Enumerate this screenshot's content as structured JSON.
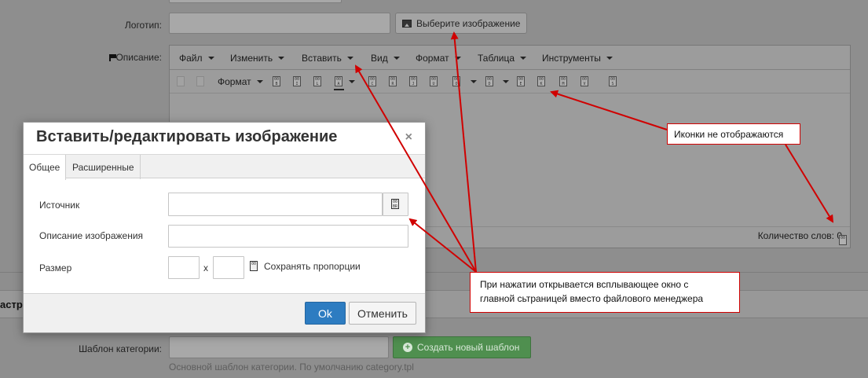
{
  "form": {
    "logo_label": "Логотип:",
    "choose_image_button": "Выберите изображение",
    "description_label": "Описание:",
    "section_partial": "астр",
    "category_template_label": "Шаблон категории:",
    "create_template_button": "Создать новый шаблон",
    "category_template_hint": "Основной шаблон категории. По умолчанию category.tpl"
  },
  "editor": {
    "menu": [
      "Файл",
      "Изменить",
      "Вставить",
      "Вид",
      "Формат",
      "Таблица",
      "Инструменты"
    ],
    "toolbar_format": "Формат",
    "word_count": "Количество слов: 0"
  },
  "dialog": {
    "title": "Вставить/редактировать изображение",
    "close": "×",
    "tabs": [
      "Общее",
      "Расширенные"
    ],
    "source_label": "Источник",
    "source_value": "",
    "alt_label": "Описание изображения",
    "alt_value": "",
    "size_label": "Размер",
    "width_value": "",
    "size_x": "x",
    "height_value": "",
    "keep_ratio": "Сохранять пропорции",
    "ok": "Ok",
    "cancel": "Отменить"
  },
  "annotations": {
    "icons_missing": "Иконки не отображаются",
    "popup_line1": "При нажатии открывается всплывающее окно с",
    "popup_line2": "главной сьтраницей вместо файлового менеджера"
  },
  "colors": {
    "annotation_red": "#d00000",
    "ok_blue": "#2d7cc1",
    "create_green": "#4f8f4f"
  }
}
